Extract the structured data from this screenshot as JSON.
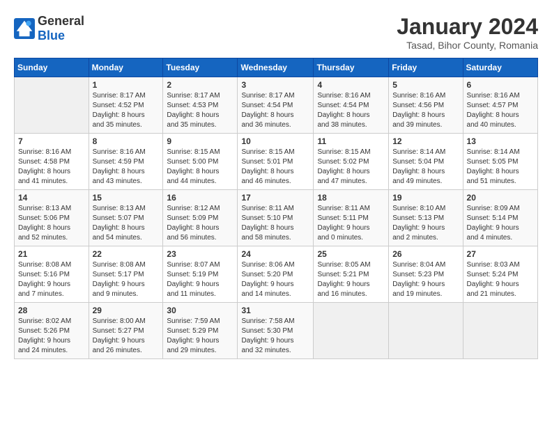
{
  "header": {
    "logo_general": "General",
    "logo_blue": "Blue",
    "title": "January 2024",
    "subtitle": "Tasad, Bihor County, Romania"
  },
  "calendar": {
    "days_of_week": [
      "Sunday",
      "Monday",
      "Tuesday",
      "Wednesday",
      "Thursday",
      "Friday",
      "Saturday"
    ],
    "weeks": [
      [
        {
          "day": "",
          "info": ""
        },
        {
          "day": "1",
          "info": "Sunrise: 8:17 AM\nSunset: 4:52 PM\nDaylight: 8 hours\nand 35 minutes."
        },
        {
          "day": "2",
          "info": "Sunrise: 8:17 AM\nSunset: 4:53 PM\nDaylight: 8 hours\nand 35 minutes."
        },
        {
          "day": "3",
          "info": "Sunrise: 8:17 AM\nSunset: 4:54 PM\nDaylight: 8 hours\nand 36 minutes."
        },
        {
          "day": "4",
          "info": "Sunrise: 8:16 AM\nSunset: 4:54 PM\nDaylight: 8 hours\nand 38 minutes."
        },
        {
          "day": "5",
          "info": "Sunrise: 8:16 AM\nSunset: 4:56 PM\nDaylight: 8 hours\nand 39 minutes."
        },
        {
          "day": "6",
          "info": "Sunrise: 8:16 AM\nSunset: 4:57 PM\nDaylight: 8 hours\nand 40 minutes."
        }
      ],
      [
        {
          "day": "7",
          "info": "Sunrise: 8:16 AM\nSunset: 4:58 PM\nDaylight: 8 hours\nand 41 minutes."
        },
        {
          "day": "8",
          "info": "Sunrise: 8:16 AM\nSunset: 4:59 PM\nDaylight: 8 hours\nand 43 minutes."
        },
        {
          "day": "9",
          "info": "Sunrise: 8:15 AM\nSunset: 5:00 PM\nDaylight: 8 hours\nand 44 minutes."
        },
        {
          "day": "10",
          "info": "Sunrise: 8:15 AM\nSunset: 5:01 PM\nDaylight: 8 hours\nand 46 minutes."
        },
        {
          "day": "11",
          "info": "Sunrise: 8:15 AM\nSunset: 5:02 PM\nDaylight: 8 hours\nand 47 minutes."
        },
        {
          "day": "12",
          "info": "Sunrise: 8:14 AM\nSunset: 5:04 PM\nDaylight: 8 hours\nand 49 minutes."
        },
        {
          "day": "13",
          "info": "Sunrise: 8:14 AM\nSunset: 5:05 PM\nDaylight: 8 hours\nand 51 minutes."
        }
      ],
      [
        {
          "day": "14",
          "info": "Sunrise: 8:13 AM\nSunset: 5:06 PM\nDaylight: 8 hours\nand 52 minutes."
        },
        {
          "day": "15",
          "info": "Sunrise: 8:13 AM\nSunset: 5:07 PM\nDaylight: 8 hours\nand 54 minutes."
        },
        {
          "day": "16",
          "info": "Sunrise: 8:12 AM\nSunset: 5:09 PM\nDaylight: 8 hours\nand 56 minutes."
        },
        {
          "day": "17",
          "info": "Sunrise: 8:11 AM\nSunset: 5:10 PM\nDaylight: 8 hours\nand 58 minutes."
        },
        {
          "day": "18",
          "info": "Sunrise: 8:11 AM\nSunset: 5:11 PM\nDaylight: 9 hours\nand 0 minutes."
        },
        {
          "day": "19",
          "info": "Sunrise: 8:10 AM\nSunset: 5:13 PM\nDaylight: 9 hours\nand 2 minutes."
        },
        {
          "day": "20",
          "info": "Sunrise: 8:09 AM\nSunset: 5:14 PM\nDaylight: 9 hours\nand 4 minutes."
        }
      ],
      [
        {
          "day": "21",
          "info": "Sunrise: 8:08 AM\nSunset: 5:16 PM\nDaylight: 9 hours\nand 7 minutes."
        },
        {
          "day": "22",
          "info": "Sunrise: 8:08 AM\nSunset: 5:17 PM\nDaylight: 9 hours\nand 9 minutes."
        },
        {
          "day": "23",
          "info": "Sunrise: 8:07 AM\nSunset: 5:19 PM\nDaylight: 9 hours\nand 11 minutes."
        },
        {
          "day": "24",
          "info": "Sunrise: 8:06 AM\nSunset: 5:20 PM\nDaylight: 9 hours\nand 14 minutes."
        },
        {
          "day": "25",
          "info": "Sunrise: 8:05 AM\nSunset: 5:21 PM\nDaylight: 9 hours\nand 16 minutes."
        },
        {
          "day": "26",
          "info": "Sunrise: 8:04 AM\nSunset: 5:23 PM\nDaylight: 9 hours\nand 19 minutes."
        },
        {
          "day": "27",
          "info": "Sunrise: 8:03 AM\nSunset: 5:24 PM\nDaylight: 9 hours\nand 21 minutes."
        }
      ],
      [
        {
          "day": "28",
          "info": "Sunrise: 8:02 AM\nSunset: 5:26 PM\nDaylight: 9 hours\nand 24 minutes."
        },
        {
          "day": "29",
          "info": "Sunrise: 8:00 AM\nSunset: 5:27 PM\nDaylight: 9 hours\nand 26 minutes."
        },
        {
          "day": "30",
          "info": "Sunrise: 7:59 AM\nSunset: 5:29 PM\nDaylight: 9 hours\nand 29 minutes."
        },
        {
          "day": "31",
          "info": "Sunrise: 7:58 AM\nSunset: 5:30 PM\nDaylight: 9 hours\nand 32 minutes."
        },
        {
          "day": "",
          "info": ""
        },
        {
          "day": "",
          "info": ""
        },
        {
          "day": "",
          "info": ""
        }
      ]
    ]
  }
}
